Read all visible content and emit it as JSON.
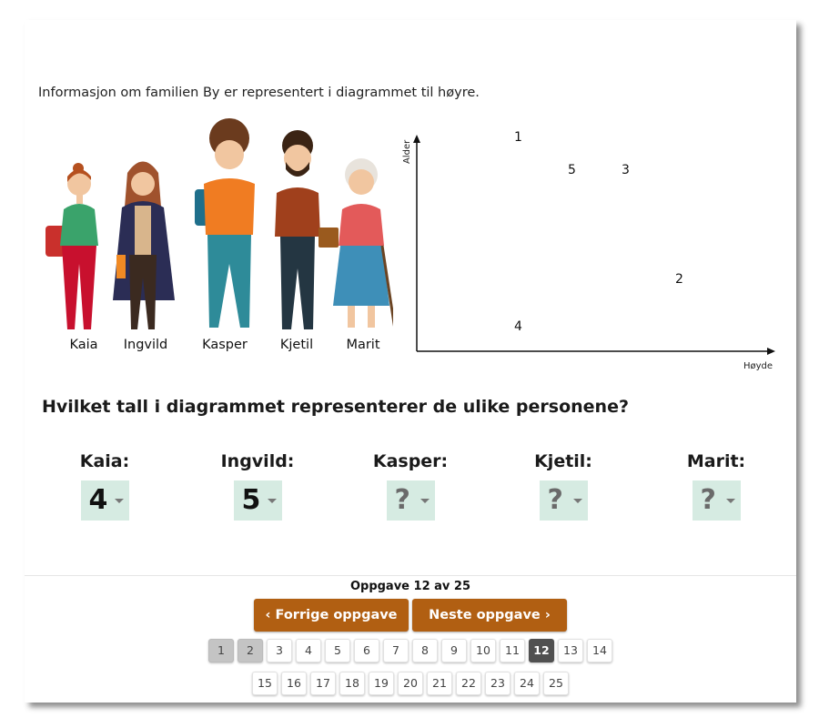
{
  "intro_text": "Informasjon om familien By er representert i diagrammet til høyre.",
  "people": [
    "Kaia",
    "Ingvild",
    "Kasper",
    "Kjetil",
    "Marit"
  ],
  "diagram": {
    "y_axis_label": "Alder",
    "x_axis_label": "Høyde",
    "points": [
      {
        "label": "1",
        "hoyde_rank": 2,
        "alder_rank": 5
      },
      {
        "label": "5",
        "hoyde_rank": 3,
        "alder_rank": 4
      },
      {
        "label": "3",
        "hoyde_rank": 4,
        "alder_rank": 4
      },
      {
        "label": "2",
        "hoyde_rank": 5,
        "alder_rank": 2
      },
      {
        "label": "4",
        "hoyde_rank": 2,
        "alder_rank": 1
      }
    ]
  },
  "question": "Hvilket tall i diagrammet representerer de ulike personene?",
  "answers": [
    {
      "label": "Kaia:",
      "value": "4"
    },
    {
      "label": "Ingvild:",
      "value": "5"
    },
    {
      "label": "Kasper:",
      "value": "?"
    },
    {
      "label": "Kjetil:",
      "value": "?"
    },
    {
      "label": "Marit:",
      "value": "?"
    }
  ],
  "footer": {
    "progress": "Oppgave 12 av 25",
    "prev_label": "Forrige oppgave",
    "next_label": "Neste oppgave"
  },
  "pager": {
    "row1": [
      "1",
      "2",
      "3",
      "4",
      "5",
      "6",
      "7",
      "8",
      "9",
      "10",
      "11",
      "12",
      "13",
      "14"
    ],
    "row2": [
      "15",
      "16",
      "17",
      "18",
      "19",
      "20",
      "21",
      "22",
      "23",
      "24",
      "25"
    ],
    "done": [
      "1",
      "2"
    ],
    "current": "12"
  },
  "colors": {
    "button": "#b15f12",
    "answer_bg": "#d6ebe2",
    "page_current": "#505050",
    "page_done": "#c4c4c4"
  }
}
